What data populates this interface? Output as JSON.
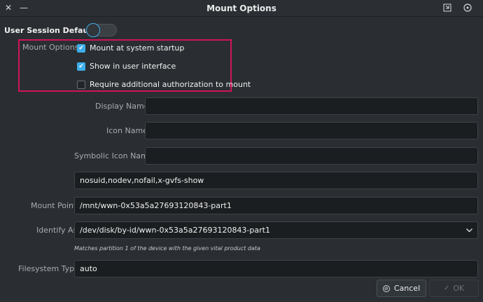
{
  "window": {
    "title": "Mount Options"
  },
  "session": {
    "label": "User Session Defaults",
    "enabled": false
  },
  "mount_options": {
    "label": "Mount Options",
    "items": [
      {
        "label": "Mount at system startup",
        "checked": true
      },
      {
        "label": "Show in user interface",
        "checked": true
      },
      {
        "label": "Require additional authorization to mount",
        "checked": false
      }
    ]
  },
  "fields": {
    "display_name": {
      "label": "Display Name",
      "value": ""
    },
    "icon_name": {
      "label": "Icon Name",
      "value": ""
    },
    "symbolic_icon_name": {
      "label": "Symbolic Icon Name",
      "value": ""
    },
    "options_value": "nosuid,nodev,nofail,x-gvfs-show",
    "mount_point": {
      "label": "Mount Point",
      "value": "/mnt/wwn-0x53a5a27693120843-part1"
    },
    "identify_as": {
      "label": "Identify As",
      "value": "/dev/disk/by-id/wwn-0x53a5a27693120843-part1",
      "hint": "Matches partition 1 of the device with the given vital product data"
    },
    "filesystem_type": {
      "label": "Filesystem Type",
      "value": "auto"
    }
  },
  "buttons": {
    "cancel": "Cancel",
    "ok": "OK"
  },
  "colors": {
    "accent": "#3daee9",
    "highlight": "#d0145a"
  }
}
